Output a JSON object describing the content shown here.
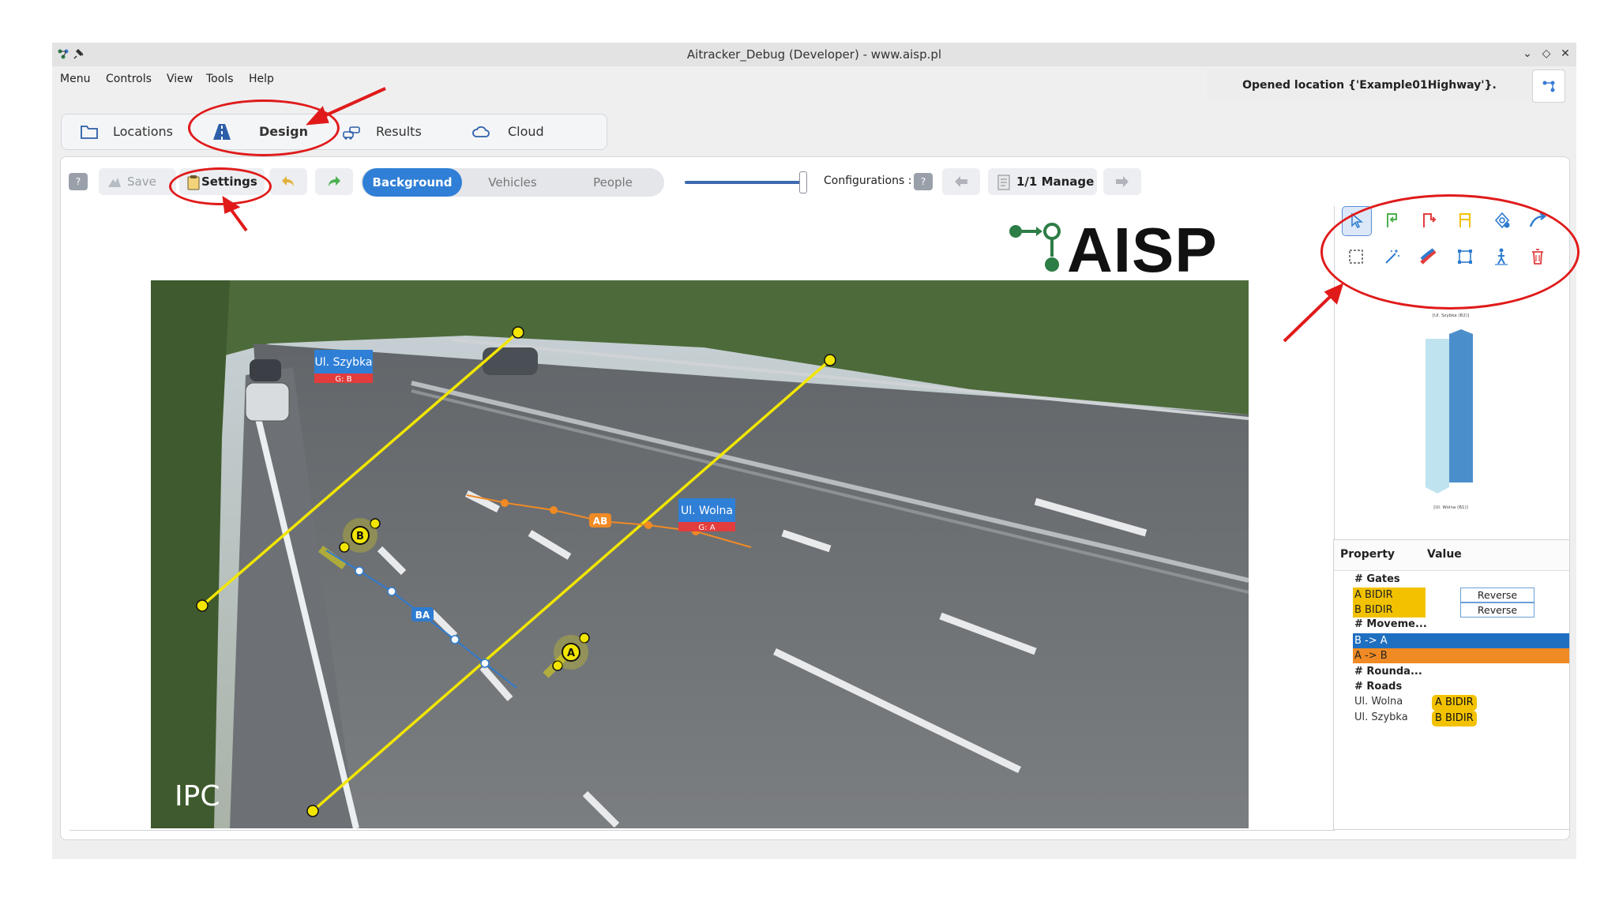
{
  "window": {
    "title": "Aitracker_Debug (Developer) - www.aisp.pl"
  },
  "menu": [
    "Menu",
    "Controls",
    "View",
    "Tools",
    "Help"
  ],
  "status": {
    "message": "Opened location {'Example01Highway'}."
  },
  "tabs": [
    {
      "label": "Locations",
      "icon": "folder-icon"
    },
    {
      "label": "Design",
      "icon": "road-icon",
      "active": true
    },
    {
      "label": "Results",
      "icon": "traffic-jam-icon"
    },
    {
      "label": "Cloud",
      "icon": "cloud-icon"
    }
  ],
  "toolbar": {
    "help": "?",
    "save": "Save",
    "settings": "Settings",
    "segments": [
      "Background",
      "Vehicles",
      "People"
    ],
    "active_segment": "Background",
    "configurations_label": "Configurations :",
    "config_help": "?",
    "manage": "1/1 Manage",
    "slider_value": 1.0
  },
  "video": {
    "logo_text": "AISP",
    "watermark": "IPC",
    "roads": [
      {
        "name": "Ul. Szybka",
        "gate": "G: B"
      },
      {
        "name": "Ul. Wolna",
        "gate": "G: A"
      }
    ],
    "gates": [
      "A",
      "B"
    ],
    "movements": [
      "AB",
      "BA"
    ],
    "colors": {
      "gate": "#f2e600",
      "ab": "#f08a24",
      "ba": "#2e7bcf",
      "road_label": "#2f7fd6",
      "gate_label": "#e33c3c"
    }
  },
  "mini_map": {
    "top_label": "[Ul. Szybka (B2)]",
    "bottom_label": "[Ul. Wolna (B1)]"
  },
  "properties": {
    "headers": {
      "property": "Property",
      "value": "Value"
    },
    "gates_header": "# Gates",
    "gates": [
      {
        "name": "A BIDIR",
        "action": "Reverse"
      },
      {
        "name": "B BIDIR",
        "action": "Reverse"
      }
    ],
    "movements_header": "# Moveme...",
    "movements": [
      {
        "name": "B -> A",
        "color": "#1f6fc0"
      },
      {
        "name": "A -> B",
        "color": "#f08a24"
      }
    ],
    "roundabouts_header": "# Rounda...",
    "roads_header": "# Roads",
    "roads": [
      {
        "name": "Ul. Wolna",
        "gate": "A BIDIR"
      },
      {
        "name": "Ul. Szybka",
        "gate": "B BIDIR"
      }
    ]
  }
}
